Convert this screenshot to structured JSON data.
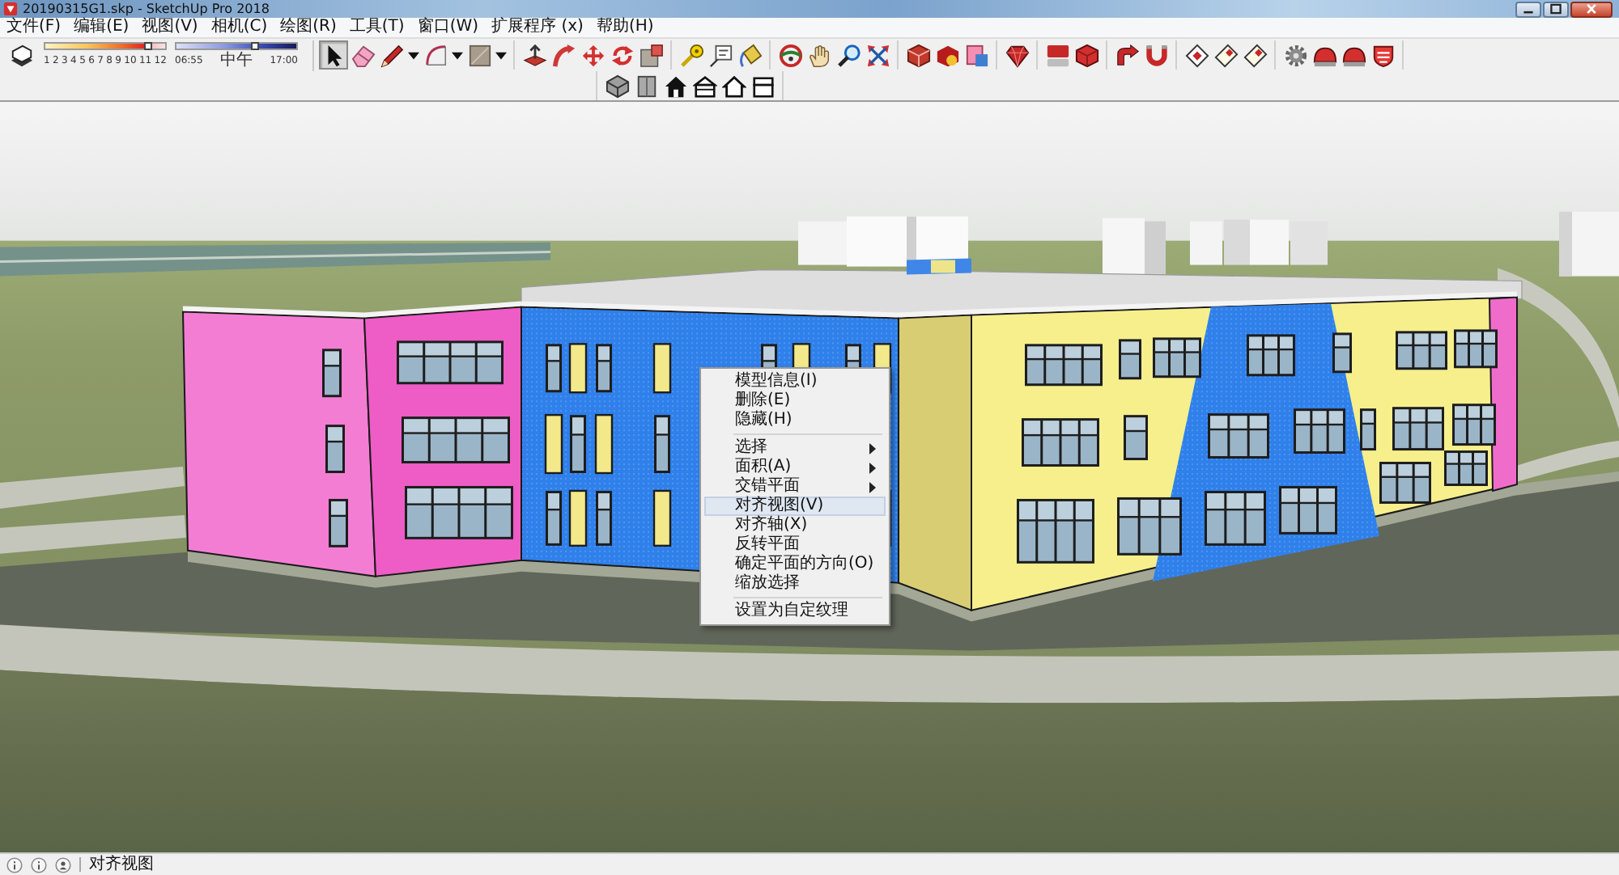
{
  "window": {
    "title": "20190315G1.skp - SketchUp Pro 2018"
  },
  "menu_bar": [
    "文件(F)",
    "编辑(E)",
    "视图(V)",
    "相机(C)",
    "绘图(R)",
    "工具(T)",
    "窗口(W)",
    "扩展程序 (x)",
    "帮助(H)"
  ],
  "shadow_settings": {
    "month_slider": {
      "labels": [
        "1",
        "2",
        "3",
        "4",
        "5",
        "6",
        "7",
        "8",
        "9",
        "10",
        "11",
        "12"
      ],
      "level": 0.86
    },
    "time_slider": {
      "start": "06:55",
      "middle": "中午",
      "end": "17:00",
      "level": 0.66
    }
  },
  "toolbar": {
    "groups": [
      [
        {
          "kind": "select",
          "selected": true
        },
        {
          "kind": "eraser",
          "selected": false
        },
        {
          "kind": "pencil",
          "selected": false
        },
        {
          "kind": "caret",
          "selected": false
        },
        {
          "kind": "arc",
          "selected": false
        },
        {
          "kind": "caret",
          "selected": false
        },
        {
          "kind": "shape",
          "selected": false
        },
        {
          "kind": "caret",
          "selected": false
        }
      ],
      [
        {
          "kind": "push_pull",
          "selected": false
        },
        {
          "kind": "follow_me",
          "selected": false
        },
        {
          "kind": "move",
          "selected": false
        },
        {
          "kind": "rotate",
          "selected": false
        },
        {
          "kind": "scale",
          "selected": false
        }
      ],
      [
        {
          "kind": "tape",
          "selected": false
        },
        {
          "kind": "text",
          "selected": false
        },
        {
          "kind": "paint",
          "selected": false
        }
      ],
      [
        {
          "kind": "orbit",
          "selected": false
        },
        {
          "kind": "pan",
          "selected": false
        },
        {
          "kind": "zoom",
          "selected": false
        },
        {
          "kind": "zoom_extents",
          "selected": false
        }
      ],
      [
        {
          "kind": "cube_box",
          "selected": false
        },
        {
          "kind": "badge_box",
          "selected": false
        },
        {
          "kind": "pages",
          "selected": false
        }
      ],
      [
        {
          "kind": "gem",
          "selected": false
        }
      ],
      [
        {
          "kind": "blocks",
          "selected": false
        },
        {
          "kind": "cube",
          "selected": false
        }
      ],
      [
        {
          "kind": "bent_arrow",
          "selected": false
        },
        {
          "kind": "magnet",
          "selected": false
        }
      ],
      [
        {
          "kind": "diamond_card",
          "selected": false
        },
        {
          "kind": "tag",
          "selected": false
        },
        {
          "kind": "tag",
          "selected": false
        }
      ],
      [
        {
          "kind": "gear",
          "selected": false
        },
        {
          "kind": "dome",
          "selected": false
        },
        {
          "kind": "dome",
          "selected": false
        },
        {
          "kind": "shield",
          "selected": false
        }
      ]
    ]
  },
  "view_toolbar": {
    "tools": [
      {
        "kind": "iso",
        "selected": false
      },
      {
        "kind": "top",
        "selected": false
      },
      {
        "kind": "front",
        "selected": false
      },
      {
        "kind": "right",
        "selected": false
      },
      {
        "kind": "back",
        "selected": false
      },
      {
        "kind": "left",
        "selected": false
      }
    ]
  },
  "context_menu": {
    "groups": [
      [
        {
          "label": "模型信息(I)",
          "submenu": false,
          "selected": false
        },
        {
          "label": "删除(E)",
          "submenu": false,
          "selected": false
        },
        {
          "label": "隐藏(H)",
          "submenu": false,
          "selected": false
        }
      ],
      [
        {
          "label": "选择",
          "submenu": true,
          "selected": false
        },
        {
          "label": "面积(A)",
          "submenu": true,
          "selected": false
        },
        {
          "label": "交错平面",
          "submenu": true,
          "selected": false
        },
        {
          "label": "对齐视图(V)",
          "submenu": false,
          "selected": true
        },
        {
          "label": "对齐轴(X)",
          "submenu": false,
          "selected": false
        },
        {
          "label": "反转平面",
          "submenu": false,
          "selected": false
        },
        {
          "label": "确定平面的方向(O)",
          "submenu": false,
          "selected": false
        },
        {
          "label": "缩放选择",
          "submenu": false,
          "selected": false
        }
      ],
      [
        {
          "label": "设置为自定纹理",
          "submenu": false,
          "selected": false
        }
      ]
    ]
  },
  "status_bar": {
    "text": "对齐视图"
  }
}
